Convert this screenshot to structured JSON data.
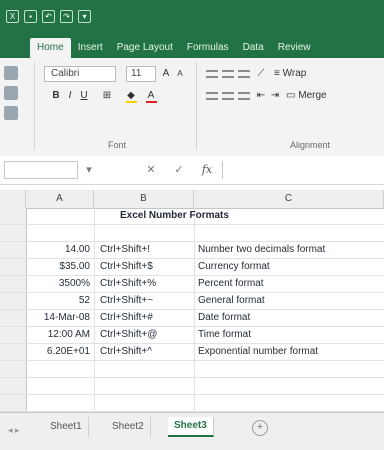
{
  "window": {
    "accent_color": "#217346",
    "qat_icons": [
      "excel-logo-icon",
      "save-icon",
      "undo-icon",
      "redo-icon",
      "customize-icon"
    ]
  },
  "ribbon": {
    "tabs": [
      {
        "label": "Home",
        "active": true
      },
      {
        "label": "Insert",
        "active": false
      },
      {
        "label": "Page Layout",
        "active": false
      },
      {
        "label": "Formulas",
        "active": false
      },
      {
        "label": "Data",
        "active": false
      },
      {
        "label": "Review",
        "active": false
      }
    ],
    "font_name": "Calibri",
    "font_size": "11",
    "bold": "B",
    "italic": "I",
    "underline": "U",
    "grow_font": "A",
    "shrink_font": "A",
    "font_color": "A",
    "wrap_text": "Wrap",
    "merge": "Merge",
    "group_labels": {
      "font": "Font",
      "alignment": "Alignment"
    }
  },
  "formula_bar": {
    "name_box": "",
    "fx": "fx",
    "cancel": "✕",
    "enter": "✓",
    "content": ""
  },
  "grid": {
    "columns": [
      "A",
      "B",
      "C"
    ],
    "title": "Excel Number Formats",
    "rows": [
      {
        "value": "14.00",
        "shortcut": "Ctrl+Shift+!",
        "description": "Number two decimals format"
      },
      {
        "value": "$35.00",
        "shortcut": "Ctrl+Shift+$",
        "description": "Currency format"
      },
      {
        "value": "3500%",
        "shortcut": "Ctrl+Shift+%",
        "description": "Percent format"
      },
      {
        "value": "52",
        "shortcut": "Ctrl+Shift+~",
        "description": "General format"
      },
      {
        "value": "14-Mar-08",
        "shortcut": "Ctrl+Shift+#",
        "description": "Date format"
      },
      {
        "value": "12:00 AM",
        "shortcut": "Ctrl+Shift+@",
        "description": "Time format"
      },
      {
        "value": "6.20E+01",
        "shortcut": "Ctrl+Shift+^",
        "description": "Exponential number format"
      }
    ]
  },
  "sheets": {
    "tabs": [
      {
        "label": "Sheet1",
        "active": false
      },
      {
        "label": "Sheet2",
        "active": false
      },
      {
        "label": "Sheet3",
        "active": true
      }
    ],
    "add_label": "+"
  }
}
